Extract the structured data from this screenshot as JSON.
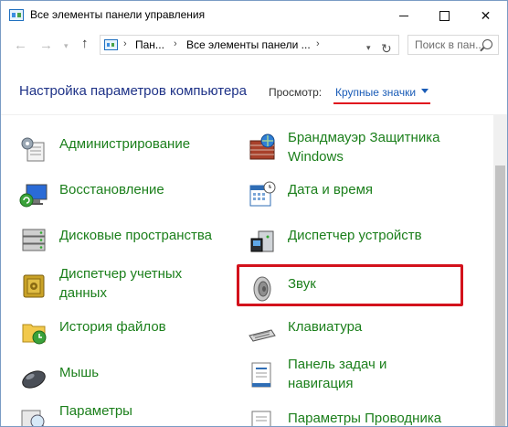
{
  "window": {
    "title": "Все элементы панели управления",
    "minimize_icon": "minimize-icon",
    "maximize_icon": "maximize-icon",
    "close_glyph": "✕"
  },
  "nav": {
    "back_glyph": "←",
    "forward_glyph": "→",
    "recent_glyph": "▾",
    "up_glyph": "↑",
    "breadcrumbs": [
      "Пан...",
      "Все элементы панели ..."
    ],
    "crumb_sep": "›",
    "refresh_glyph": "↻",
    "search_placeholder": "Поиск в пан..."
  },
  "header": {
    "title": "Настройка параметров компьютера",
    "view_label": "Просмотр:",
    "view_value": "Крупные значки",
    "accent_color": "#1a5cb7",
    "highlight_color": "#d3121c"
  },
  "items": [
    {
      "label": "Администрирование",
      "icon": "admin-tools-icon"
    },
    {
      "label": "Брандмауэр Защитника Windows",
      "icon": "firewall-icon"
    },
    {
      "label": "Восстановление",
      "icon": "recovery-icon"
    },
    {
      "label": "Дата и время",
      "icon": "calendar-icon"
    },
    {
      "label": "Дисковые пространства",
      "icon": "storage-spaces-icon"
    },
    {
      "label": "Диспетчер устройств",
      "icon": "device-manager-icon"
    },
    {
      "label": "Диспетчер учетных данных",
      "icon": "credential-vault-icon"
    },
    {
      "label": "Звук",
      "icon": "speaker-icon",
      "highlighted": true
    },
    {
      "label": "История файлов",
      "icon": "file-history-icon"
    },
    {
      "label": "Клавиатура",
      "icon": "keyboard-icon"
    },
    {
      "label": "Мышь",
      "icon": "mouse-icon"
    },
    {
      "label": "Панель задач и навигация",
      "icon": "taskbar-icon"
    },
    {
      "label": "Параметры",
      "icon": "indexing-options-icon"
    },
    {
      "label": "Параметры Проводника",
      "icon": "folder-options-icon"
    }
  ]
}
